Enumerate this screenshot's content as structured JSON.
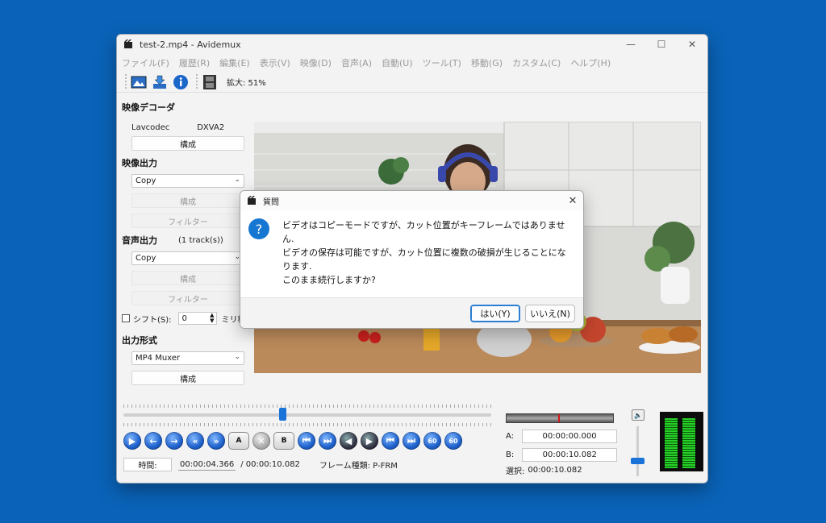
{
  "window": {
    "title": "test-2.mp4 - Avidemux"
  },
  "menu": [
    "ファイル(F)",
    "履歴(R)",
    "編集(E)",
    "表示(V)",
    "映像(D)",
    "音声(A)",
    "自動(U)",
    "ツール(T)",
    "移動(G)",
    "カスタム(C)",
    "ヘルプ(H)"
  ],
  "toolbar": {
    "zoom_label": "拡大: 51%"
  },
  "video_decoder": {
    "title": "映像デコーダ",
    "codec": "Lavcodec",
    "hw": "DXVA2",
    "configure": "構成"
  },
  "video_output": {
    "title": "映像出力",
    "selected": "Copy",
    "configure": "構成",
    "filters": "フィルター"
  },
  "audio_output": {
    "title": "音声出力",
    "tracks": "(1 track(s))",
    "selected": "Copy",
    "configure": "構成",
    "filters": "フィルター",
    "shift_label": "シフト(S):",
    "shift_value": "0",
    "shift_unit": "ミリ秒"
  },
  "output_format": {
    "title": "出力形式",
    "selected": "MP4 Muxer",
    "configure": "構成"
  },
  "controls": {
    "ab_a": "A",
    "ab_b": "B",
    "sixty": "60"
  },
  "time": {
    "button": "時間:",
    "current": "00:00:04.366",
    "total": "/ 00:00:10.082",
    "frame_type": "フレーム種類: P-FRM"
  },
  "selection": {
    "a_label": "A:",
    "a_value": "00:00:00.000",
    "b_label": "B:",
    "b_value": "00:00:10.082",
    "sel_label": "選択:",
    "sel_value": "00:00:10.082"
  },
  "seek": {
    "position": 0.433
  },
  "dialog": {
    "title": "質問",
    "line1": "ビデオはコピーモードですが、カット位置がキーフレームではありませ",
    "line2": "ん.",
    "line3": "ビデオの保存は可能ですが、カット位置に複数の破損が生じることにな",
    "line4": "ります.",
    "line5": "このまま続行しますか?",
    "yes": "はい(Y)",
    "no": "いいえ(N)"
  }
}
